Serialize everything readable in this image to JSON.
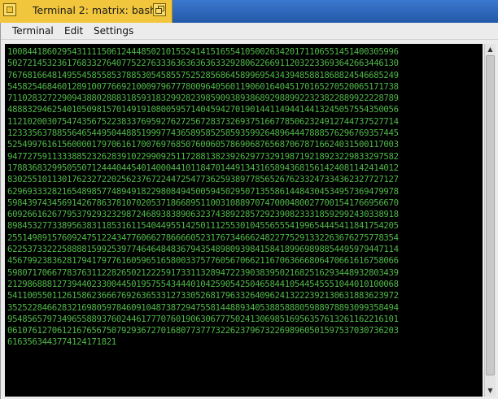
{
  "window": {
    "title": "Terminal 2: matrix: bash",
    "tab_color": "#f1c63c",
    "frame_color": "#2a63b6"
  },
  "menubar": {
    "items": [
      {
        "label": "Terminal"
      },
      {
        "label": "Edit"
      },
      {
        "label": "Settings"
      }
    ]
  },
  "terminal": {
    "text_color": "#4fb848",
    "background": "#000000",
    "lines": [
      "1008441860295431111506124448502101552414151655410500263420171106551451400305996",
      "5027214532361768332764077522763336363636363329280622669112032233693642663446130",
      "7676816648149554585585378853054585575252856864589969543439485881868824546685249",
      "5458254684601289100776692100097967778009640560119060164045170165270520065171738",
      "7110283272290943880288831859318329928239859093893868929889922323822889922228789",
      "4888329462540105098157014919108005957140459427019014411494414413245057554350056",
      "1121020030754743567522383376959276272567283732693751667785062324912744737527714",
      "1233356378855646544950448851999774365895852585935992648964447888576296769357445",
      "5254997616156000017970616170076976850760060578690687656870678716624031500117003",
      "9477275911333885232628391022990925117288138239262977329198719218923229833297582",
      "1788368329950550712444044540140004410118470144913431658943681561424081142414012",
      "8302551011301762327220256237672244725477362593897785652676233247334362327727127",
      "6296933328216548985774894918229808494500594502950713558614484304534957369479978",
      "5984397434569142678637810702053718668951100310889707470004800277001541766956670",
      "6092661626779537929323298724689383890632374389228572923908233318592992430338918",
      "8984532773389563831185316115404495514250111255301045565554199654445411841754205",
      "2551498915760924751224347760662786666052317673466624822775291332263676275778354",
      "6225373322258888159925397746464848367943548980939841584189969898854495979447114",
      "4567992383628179417977616059651658003375776056706621167063666806470661616758066",
      "5980717066778376311228265021222591733113289472239038395021682516293448932803439",
      "2129868881273944023300445019575543444010425905425046584410544545551044010100068",
      "5411005501126158623666769263653312733052681796332640962413222392130631883623972",
      "3525228466283216980597846091048738729475581448893405388588805988978893099358494",
      "9548565797349655889376024461777076019063067775024130698516956357613261162216101",
      "0610761270612167656750792936727016807737773226237967322698960501597537030736203",
      "6163563443774124171821"
    ]
  },
  "scrollbar": {
    "up_icon": "arrow-up-icon",
    "down_icon": "arrow-down-icon",
    "thumb_position": 0.0,
    "thumb_fraction": 0.97
  }
}
